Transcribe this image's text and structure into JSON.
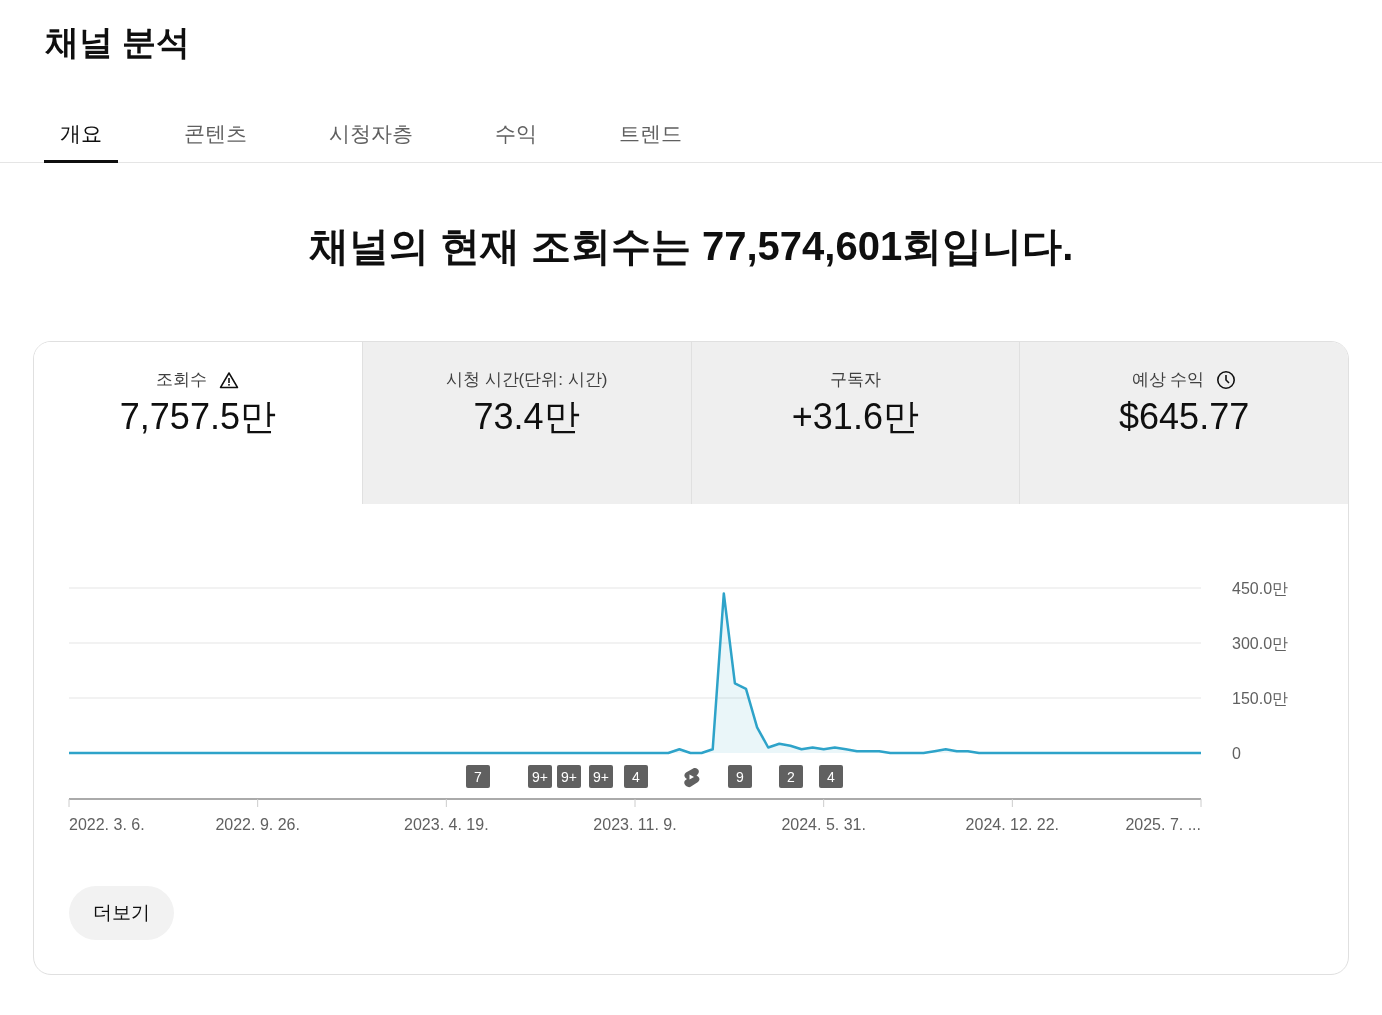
{
  "page_title": "채널 분석",
  "tabs": [
    {
      "label": "개요",
      "selected": true
    },
    {
      "label": "콘텐츠",
      "selected": false
    },
    {
      "label": "시청자층",
      "selected": false
    },
    {
      "label": "수익",
      "selected": false
    },
    {
      "label": "트렌드",
      "selected": false
    }
  ],
  "headline": "채널의 현재 조회수는 77,574,601회입니다.",
  "stats": [
    {
      "label": "조회수",
      "value": "7,757.5만",
      "kind": "warning",
      "selected": true
    },
    {
      "label": "시청 시간(단위: 시간)",
      "value": "73.4만",
      "kind": "plain",
      "selected": false
    },
    {
      "label": "구독자",
      "value": "+31.6만",
      "kind": "plain",
      "selected": false
    },
    {
      "label": "예상 수익",
      "value": "$645.77",
      "kind": "clock",
      "selected": false
    }
  ],
  "chart_data": {
    "type": "area",
    "ylim": [
      0,
      450
    ],
    "categories": [
      "2022. 3. 6.",
      null,
      null,
      null,
      null,
      null,
      null,
      null,
      null,
      null,
      null,
      null,
      null,
      null,
      null,
      null,
      null,
      "2022. 9. 26.",
      null,
      null,
      null,
      null,
      null,
      null,
      null,
      null,
      null,
      null,
      null,
      null,
      null,
      null,
      null,
      null,
      "2023. 4. 19.",
      null,
      null,
      null,
      null,
      null,
      null,
      null,
      null,
      null,
      null,
      null,
      null,
      null,
      null,
      null,
      null,
      "2023. 11. 9.",
      null,
      null,
      null,
      null,
      null,
      null,
      null,
      null,
      null,
      null,
      null,
      null,
      null,
      null,
      null,
      null,
      "2024. 5. 31.",
      null,
      null,
      null,
      null,
      null,
      null,
      null,
      null,
      null,
      null,
      null,
      null,
      null,
      null,
      null,
      null,
      "2024. 12. 22.",
      null,
      null,
      null,
      null,
      null,
      null,
      null,
      null,
      null,
      null,
      null,
      null,
      null,
      null,
      null,
      null,
      "2025. 7. ..."
    ],
    "yticks": [
      {
        "value": 0,
        "label": "0"
      },
      {
        "value": 150,
        "label": "150.0만"
      },
      {
        "value": 300,
        "label": "300.0만"
      },
      {
        "value": 450,
        "label": "450.0만"
      }
    ],
    "series": [
      {
        "color": "#2ea3c9",
        "values": [
          0,
          0,
          0,
          0,
          0,
          0,
          0,
          0,
          0,
          0,
          0,
          0,
          0,
          0,
          0,
          0,
          0,
          0,
          0,
          0,
          0,
          0,
          0,
          0,
          0,
          0,
          0,
          0,
          0,
          0,
          0,
          0,
          0,
          0,
          0,
          0,
          0,
          0,
          0,
          0,
          0,
          0,
          0,
          0,
          0,
          0,
          0,
          0,
          0,
          0,
          0,
          0,
          0,
          0,
          0,
          10,
          0,
          0,
          10,
          435,
          190,
          175,
          70,
          15,
          25,
          20,
          10,
          15,
          10,
          15,
          10,
          5,
          5,
          5,
          0,
          0,
          0,
          0,
          5,
          10,
          5,
          5,
          0,
          0,
          0,
          0,
          0,
          0,
          0,
          0,
          0,
          0,
          0,
          0,
          0,
          0,
          0,
          0,
          0,
          0,
          0,
          0,
          0
        ]
      }
    ]
  },
  "video_markers": [
    {
      "kind": "count",
      "label": "7"
    },
    {
      "kind": "count",
      "label": "9+"
    },
    {
      "kind": "count",
      "label": "9+"
    },
    {
      "kind": "count",
      "label": "9+"
    },
    {
      "kind": "count",
      "label": "4"
    },
    {
      "kind": "shorts"
    },
    {
      "kind": "count",
      "label": "9"
    },
    {
      "kind": "count",
      "label": "2"
    },
    {
      "kind": "count",
      "label": "4"
    }
  ],
  "more_button": "더보기"
}
